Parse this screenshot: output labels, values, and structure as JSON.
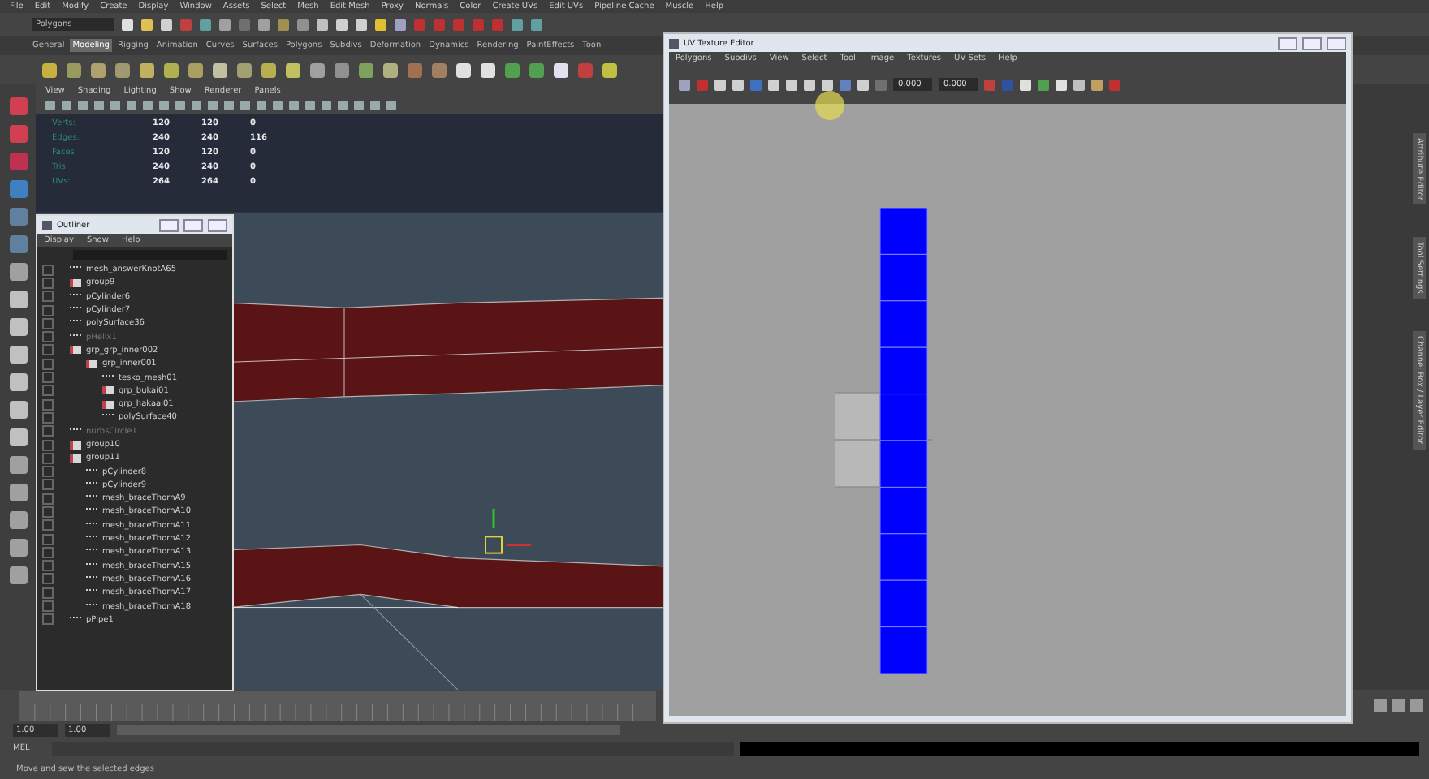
{
  "menu_bar": [
    "File",
    "Edit",
    "Modify",
    "Create",
    "Display",
    "Window",
    "Assets",
    "Select",
    "Mesh",
    "Edit Mesh",
    "Proxy",
    "Normals",
    "Color",
    "Create UVs",
    "Edit UVs",
    "Pipeline Cache",
    "Muscle",
    "Help"
  ],
  "status_line": {
    "mode": "Polygons"
  },
  "shelf_tabs": [
    {
      "label": "General",
      "selected": false
    },
    {
      "label": "Modeling",
      "selected": true
    },
    {
      "label": "Rigging",
      "selected": false
    },
    {
      "label": "Animation",
      "selected": false
    },
    {
      "label": "Curves",
      "selected": false
    },
    {
      "label": "Surfaces",
      "selected": false
    },
    {
      "label": "Polygons",
      "selected": false
    },
    {
      "label": "Subdivs",
      "selected": false
    },
    {
      "label": "Deformation",
      "selected": false
    },
    {
      "label": "Dynamics",
      "selected": false
    },
    {
      "label": "Rendering",
      "selected": false
    },
    {
      "label": "PaintEffects",
      "selected": false
    },
    {
      "label": "Toon",
      "selected": false
    }
  ],
  "viewport": {
    "menu": [
      "View",
      "Shading",
      "Lighting",
      "Show",
      "Renderer",
      "Panels"
    ],
    "hud": [
      {
        "label": "Verts:",
        "values": [
          "120",
          "120",
          "0"
        ]
      },
      {
        "label": "Edges:",
        "values": [
          "240",
          "240",
          "116"
        ]
      },
      {
        "label": "Faces:",
        "values": [
          "120",
          "120",
          "0"
        ]
      },
      {
        "label": "Tris:",
        "values": [
          "240",
          "240",
          "0"
        ]
      },
      {
        "label": "UVs:",
        "values": [
          "264",
          "264",
          "0"
        ]
      }
    ]
  },
  "outliner": {
    "title": "Outliner",
    "menu": [
      "Display",
      "Show",
      "Help"
    ],
    "items": [
      {
        "name": "mesh_answerKnotA65",
        "kind": "mesh",
        "dimmed": false
      },
      {
        "name": "group9",
        "kind": "group",
        "dimmed": false
      },
      {
        "name": "pCylinder6",
        "kind": "mesh",
        "dimmed": false
      },
      {
        "name": "pCylinder7",
        "kind": "mesh",
        "dimmed": false
      },
      {
        "name": "polySurface36",
        "kind": "mesh",
        "dimmed": false
      },
      {
        "name": "pHelix1",
        "kind": "mesh",
        "dimmed": true
      },
      {
        "name": "grp_grp_inner002",
        "kind": "group",
        "dimmed": false,
        "children": [
          {
            "name": "grp_inner001",
            "kind": "group",
            "dimmed": false,
            "children": [
              {
                "name": "tesko_mesh01",
                "kind": "mesh",
                "dimmed": false
              },
              {
                "name": "grp_bukai01",
                "kind": "group",
                "dimmed": false
              },
              {
                "name": "grp_hakaai01",
                "kind": "group",
                "dimmed": false
              },
              {
                "name": "polySurface40",
                "kind": "mesh",
                "dimmed": false
              }
            ]
          }
        ]
      },
      {
        "name": "nurbsCircle1",
        "kind": "mesh",
        "dimmed": true
      },
      {
        "name": "group10",
        "kind": "group",
        "dimmed": false
      },
      {
        "name": "group11",
        "kind": "group",
        "dimmed": false,
        "children": [
          {
            "name": "pCylinder8",
            "kind": "mesh",
            "dimmed": false
          },
          {
            "name": "pCylinder9",
            "kind": "mesh",
            "dimmed": false
          },
          {
            "name": "mesh_braceThornA9",
            "kind": "mesh",
            "dimmed": false
          },
          {
            "name": "mesh_braceThornA10",
            "kind": "mesh",
            "dimmed": false
          },
          {
            "name": "mesh_braceThornA11",
            "kind": "mesh",
            "dimmed": false
          },
          {
            "name": "mesh_braceThornA12",
            "kind": "mesh",
            "dimmed": false
          },
          {
            "name": "mesh_braceThornA13",
            "kind": "mesh",
            "dimmed": false
          },
          {
            "name": "mesh_braceThornA15",
            "kind": "mesh",
            "dimmed": false
          },
          {
            "name": "mesh_braceThornA16",
            "kind": "mesh",
            "dimmed": false
          },
          {
            "name": "mesh_braceThornA17",
            "kind": "mesh",
            "dimmed": false
          },
          {
            "name": "mesh_braceThornA18",
            "kind": "mesh",
            "dimmed": false
          }
        ]
      },
      {
        "name": "pPipe1",
        "kind": "mesh",
        "dimmed": false
      }
    ]
  },
  "uv_editor": {
    "title": "UV Texture Editor",
    "menu": [
      "Polygons",
      "Subdivs",
      "View",
      "Select",
      "Tool",
      "Image",
      "Textures",
      "UV Sets",
      "Help"
    ],
    "fields": [
      "0.000",
      "0.000"
    ]
  },
  "side_tabs": [
    "Attribute Editor",
    "Tool Settings",
    "Channel Box / Layer Editor"
  ],
  "range": {
    "start": "1.00",
    "end": "1.00",
    "level": 1
  },
  "command_line": {
    "label": "MEL"
  },
  "help_line": "Move and sew the selected edges"
}
